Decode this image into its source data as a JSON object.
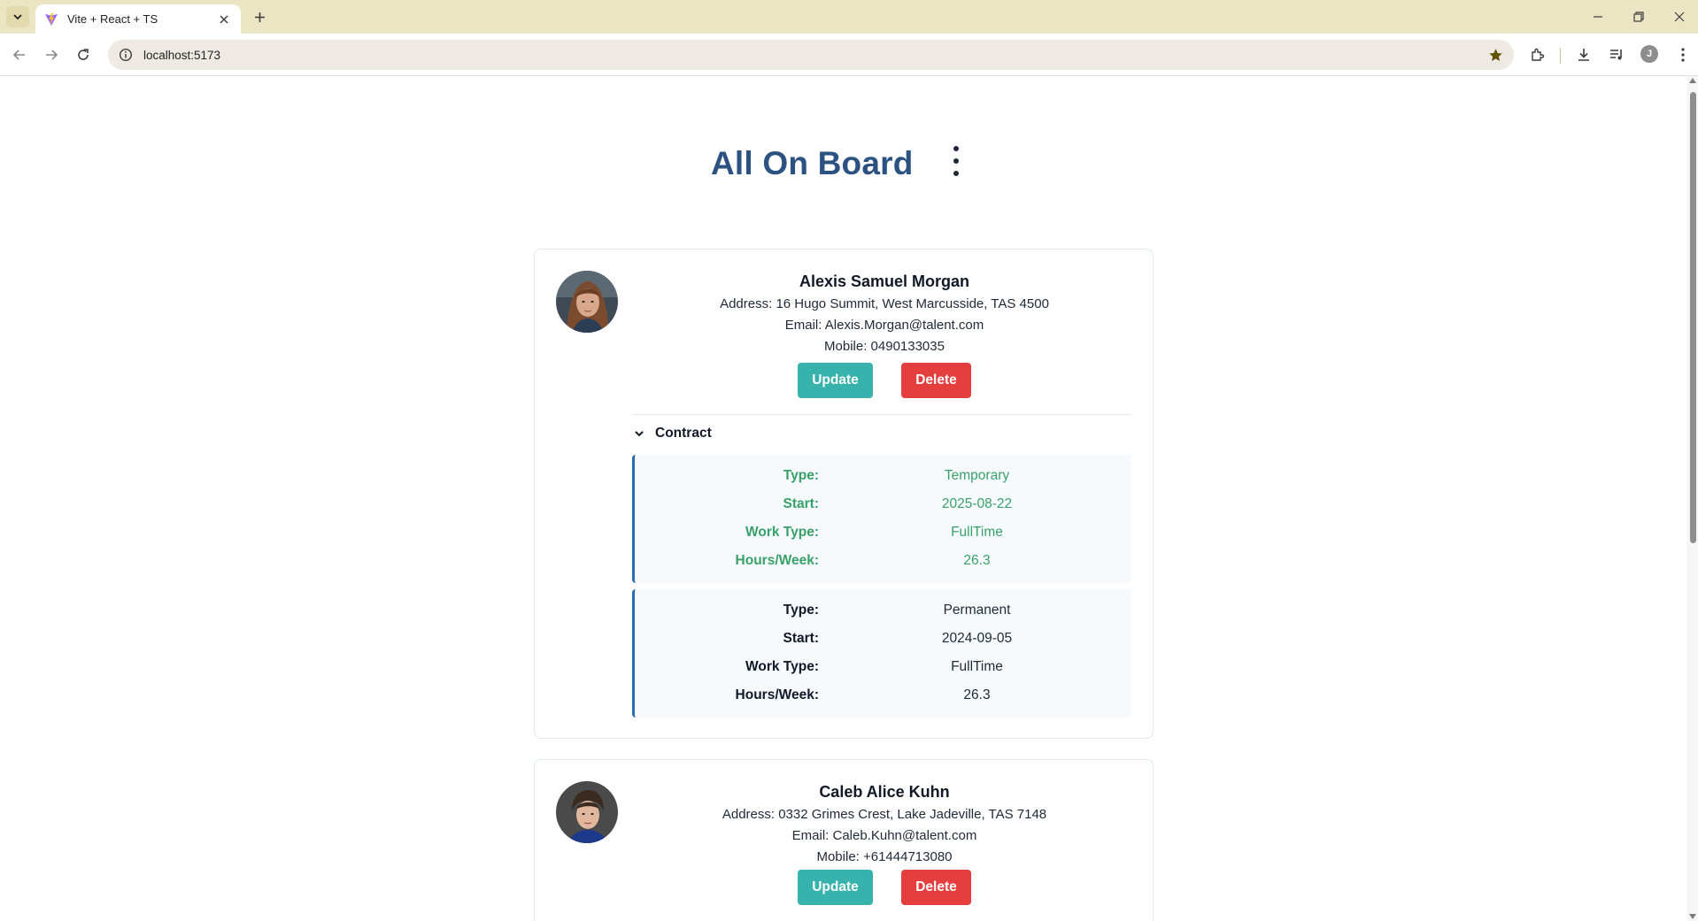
{
  "browser": {
    "tab_title": "Vite + React + TS",
    "url": "localhost:5173",
    "profile_initial": "J",
    "tab_bar_color": "#ece5c3"
  },
  "page": {
    "title": "All On Board",
    "title_color": "#2c5282"
  },
  "employees": [
    {
      "name": "Alexis Samuel Morgan",
      "address": "Address: 16 Hugo Summit, West Marcusside, TAS 4500",
      "email": "Email: Alexis.Morgan@talent.com",
      "mobile": "Mobile: 0490133035",
      "update_label": "Update",
      "delete_label": "Delete",
      "contract_label": "Contract",
      "contracts": [
        {
          "status": "active",
          "type_label": "Type:",
          "type": "Temporary",
          "start_label": "Start:",
          "start": "2025-08-22",
          "work_type_label": "Work Type:",
          "work_type": "FullTime",
          "hours_label": "Hours/Week:",
          "hours": "26.3"
        },
        {
          "status": "past",
          "type_label": "Type:",
          "type": "Permanent",
          "start_label": "Start:",
          "start": "2024-09-05",
          "work_type_label": "Work Type:",
          "work_type": "FullTime",
          "hours_label": "Hours/Week:",
          "hours": "26.3"
        }
      ]
    },
    {
      "name": "Caleb Alice Kuhn",
      "address": "Address: 0332 Grimes Crest, Lake Jadeville, TAS 7148",
      "email": "Email: Caleb.Kuhn@talent.com",
      "mobile": "Mobile: +61444713080",
      "update_label": "Update",
      "delete_label": "Delete"
    }
  ],
  "colors": {
    "update_button": "#38b2ac",
    "delete_button": "#e53e3e",
    "active_contract_text": "#38a169",
    "contract_border": "#2b6cb0"
  }
}
